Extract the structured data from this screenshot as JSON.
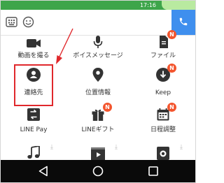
{
  "status": {
    "time": "17:16"
  },
  "menu": {
    "items": [
      {
        "label": "動画を撮る",
        "icon": "video-camera-icon"
      },
      {
        "label": "ボイスメッセージ",
        "icon": "microphone-icon"
      },
      {
        "label": "ファイル",
        "icon": "file-icon"
      },
      {
        "label": "連絡先",
        "icon": "contact-icon"
      },
      {
        "label": "位置情報",
        "icon": "location-pin-icon"
      },
      {
        "label": "Keep",
        "icon": "keep-icon"
      },
      {
        "label": "LINE Pay",
        "icon": "line-pay-icon"
      },
      {
        "label": "LINEギフト",
        "icon": "gift-icon"
      },
      {
        "label": "日程調整",
        "icon": "calendar-icon"
      },
      {
        "label": "",
        "icon": "music-note-icon"
      },
      {
        "label": "",
        "icon": "video-clip-icon"
      },
      {
        "label": "",
        "icon": "camera-app-icon"
      }
    ],
    "badge_text": "N"
  },
  "colors": {
    "statusbar": "#3ea54a",
    "send_button": "#3f8fee",
    "badge": "#f3552e",
    "highlight": "#e0282c",
    "navbar": "#0a0a0a"
  },
  "navbar": {
    "buttons": [
      "back-icon",
      "home-icon",
      "recents-icon"
    ]
  }
}
